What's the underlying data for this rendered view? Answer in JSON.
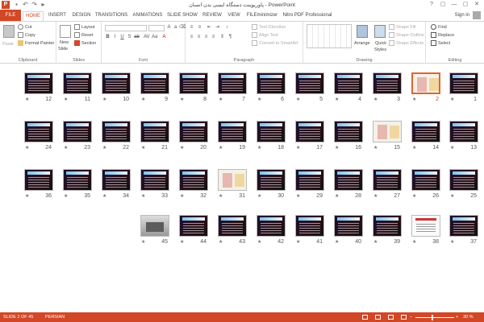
{
  "titlebar": {
    "title": "پاورپوینت دستگاه ایمنی بدن انسان - PowerPoint",
    "app_icon": "P",
    "qat_icons": [
      "save-icon",
      "undo-icon",
      "redo-icon",
      "start-from-beginning-icon"
    ],
    "window_buttons": [
      "?",
      "▢",
      "—",
      "▢",
      "✕"
    ]
  },
  "tabs": [
    "FILE",
    "HOME",
    "INSERT",
    "DESIGN",
    "TRANSITIONS",
    "ANIMATIONS",
    "SLIDE SHOW",
    "REVIEW",
    "VIEW",
    "FILEminimizer",
    "Nitro PDF Professional"
  ],
  "active_tab": "HOME",
  "sign_in": "Sign in",
  "ribbon": {
    "clipboard": {
      "label": "Clipboard",
      "paste": "Paste",
      "cut": "Cut",
      "copy": "Copy",
      "format_painter": "Format Painter"
    },
    "slides": {
      "label": "Slides",
      "new_slide": "New",
      "new_slide_2": "Slide",
      "layout": "Layout",
      "reset": "Reset",
      "section": "Section"
    },
    "font": {
      "label": "Font"
    },
    "paragraph": {
      "label": "Paragraph",
      "text_direction": "Text Direction",
      "align_text": "Align Text",
      "convert_smartart": "Convert to SmartArt"
    },
    "drawing": {
      "label": "Drawing",
      "arrange": "Arrange",
      "quick_styles": "Quick",
      "quick_styles_2": "Styles",
      "shape_fill": "Shape Fill",
      "shape_outline": "Shape Outline",
      "shape_effects": "Shape Effects"
    },
    "editing": {
      "label": "Editing",
      "find": "Find",
      "replace": "Replace",
      "select": "Select"
    }
  },
  "sorter": {
    "star": "★",
    "selected_slide": "2",
    "rows": [
      [
        {
          "num": "12",
          "style": "dark"
        },
        {
          "num": "11",
          "style": "dark"
        },
        {
          "num": "10",
          "style": "dark"
        },
        {
          "num": "9",
          "style": "dark"
        },
        {
          "num": "8",
          "style": "dark"
        },
        {
          "num": "7",
          "style": "dark"
        },
        {
          "num": "6",
          "style": "dark"
        },
        {
          "num": "5",
          "style": "dark"
        },
        {
          "num": "4",
          "style": "dark"
        },
        {
          "num": "3",
          "style": "dark"
        },
        {
          "num": "2",
          "style": "light"
        },
        {
          "num": "1",
          "style": "dark"
        }
      ],
      [
        {
          "num": "24",
          "style": "dark"
        },
        {
          "num": "23",
          "style": "dark"
        },
        {
          "num": "22",
          "style": "dark"
        },
        {
          "num": "21",
          "style": "dark"
        },
        {
          "num": "20",
          "style": "dark"
        },
        {
          "num": "19",
          "style": "dark"
        },
        {
          "num": "18",
          "style": "dark"
        },
        {
          "num": "17",
          "style": "dark"
        },
        {
          "num": "16",
          "style": "dark"
        },
        {
          "num": "15",
          "style": "light"
        },
        {
          "num": "14",
          "style": "dark"
        },
        {
          "num": "13",
          "style": "dark"
        }
      ],
      [
        {
          "num": "36",
          "style": "dark"
        },
        {
          "num": "35",
          "style": "dark"
        },
        {
          "num": "34",
          "style": "dark"
        },
        {
          "num": "33",
          "style": "dark"
        },
        {
          "num": "32",
          "style": "dark"
        },
        {
          "num": "31",
          "style": "light"
        },
        {
          "num": "30",
          "style": "dark"
        },
        {
          "num": "29",
          "style": "dark"
        },
        {
          "num": "28",
          "style": "dark"
        },
        {
          "num": "27",
          "style": "dark"
        },
        {
          "num": "26",
          "style": "dark"
        },
        {
          "num": "25",
          "style": "dark"
        }
      ],
      [
        {
          "num": "45",
          "style": "photo"
        },
        {
          "num": "44",
          "style": "dark"
        },
        {
          "num": "43",
          "style": "dark"
        },
        {
          "num": "42",
          "style": "dark"
        },
        {
          "num": "41",
          "style": "dark"
        },
        {
          "num": "40",
          "style": "dark"
        },
        {
          "num": "39",
          "style": "dark"
        },
        {
          "num": "38",
          "style": "white"
        },
        {
          "num": "37",
          "style": "dark"
        }
      ]
    ]
  },
  "statusbar": {
    "slide_info": "SLIDE 2 OF 45",
    "language": "PERSIAN",
    "zoom": "30 %",
    "zoom_minus": "−",
    "zoom_plus": "+"
  },
  "colors": {
    "accent": "#d24726",
    "selection": "#e0652f"
  }
}
